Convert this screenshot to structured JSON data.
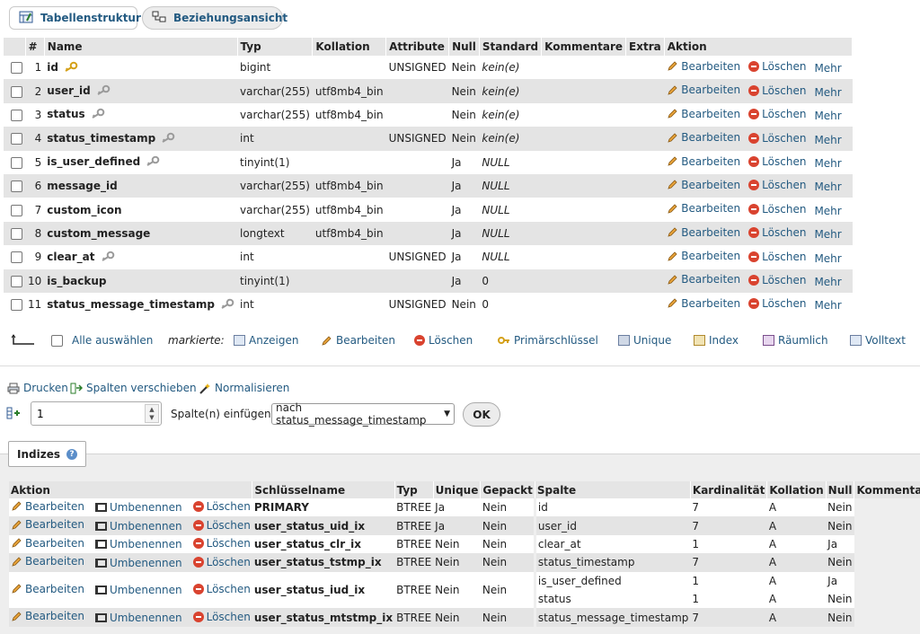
{
  "tabs": [
    {
      "label": "Tabellenstruktur",
      "icon": "table-structure-icon"
    },
    {
      "label": "Beziehungsansicht",
      "icon": "relation-view-icon"
    }
  ],
  "structure": {
    "headers": [
      "#",
      "Name",
      "Typ",
      "Kollation",
      "Attribute",
      "Null",
      "Standard",
      "Kommentare",
      "Extra",
      "Aktion"
    ],
    "action_labels": {
      "edit": "Bearbeiten",
      "delete": "Löschen",
      "more": "Mehr"
    },
    "rows": [
      {
        "num": "1",
        "name": "id",
        "type": "bigint",
        "collation": "",
        "attribute": "UNSIGNED",
        "null": "Nein",
        "default": "kein(e)",
        "key": "primary"
      },
      {
        "num": "2",
        "name": "user_id",
        "type": "varchar(255)",
        "collation": "utf8mb4_bin",
        "attribute": "",
        "null": "Nein",
        "default": "kein(e)",
        "key": "index"
      },
      {
        "num": "3",
        "name": "status",
        "type": "varchar(255)",
        "collation": "utf8mb4_bin",
        "attribute": "",
        "null": "Nein",
        "default": "kein(e)",
        "key": "index"
      },
      {
        "num": "4",
        "name": "status_timestamp",
        "type": "int",
        "collation": "",
        "attribute": "UNSIGNED",
        "null": "Nein",
        "default": "kein(e)",
        "key": "index"
      },
      {
        "num": "5",
        "name": "is_user_defined",
        "type": "tinyint(1)",
        "collation": "",
        "attribute": "",
        "null": "Ja",
        "default": "NULL",
        "key": "index"
      },
      {
        "num": "6",
        "name": "message_id",
        "type": "varchar(255)",
        "collation": "utf8mb4_bin",
        "attribute": "",
        "null": "Ja",
        "default": "NULL",
        "key": ""
      },
      {
        "num": "7",
        "name": "custom_icon",
        "type": "varchar(255)",
        "collation": "utf8mb4_bin",
        "attribute": "",
        "null": "Ja",
        "default": "NULL",
        "key": ""
      },
      {
        "num": "8",
        "name": "custom_message",
        "type": "longtext",
        "collation": "utf8mb4_bin",
        "attribute": "",
        "null": "Ja",
        "default": "NULL",
        "key": ""
      },
      {
        "num": "9",
        "name": "clear_at",
        "type": "int",
        "collation": "",
        "attribute": "UNSIGNED",
        "null": "Ja",
        "default": "NULL",
        "key": "index"
      },
      {
        "num": "10",
        "name": "is_backup",
        "type": "tinyint(1)",
        "collation": "",
        "attribute": "",
        "null": "Ja",
        "default": "0",
        "key": ""
      },
      {
        "num": "11",
        "name": "status_message_timestamp",
        "type": "int",
        "collation": "",
        "attribute": "UNSIGNED",
        "null": "Nein",
        "default": "0",
        "key": "index"
      }
    ]
  },
  "bulk": {
    "select_all": "Alle auswählen",
    "marked": "markierte:",
    "actions": [
      "Anzeigen",
      "Bearbeiten",
      "Löschen",
      "Primärschlüssel",
      "Unique",
      "Index",
      "Räumlich",
      "Volltext"
    ]
  },
  "tools": {
    "print": "Drucken",
    "move_columns": "Spalten verschieben",
    "normalize": "Normalisieren"
  },
  "add_column": {
    "count": "1",
    "label": "Spalte(n) einfügen",
    "position": "nach status_message_timestamp",
    "ok": "OK"
  },
  "indexes": {
    "legend": "Indizes",
    "headers": [
      "Aktion",
      "Schlüsselname",
      "Typ",
      "Unique",
      "Gepackt",
      "Spalte",
      "Kardinalität",
      "Kollation",
      "Null",
      "Kommentar"
    ],
    "action_labels": {
      "edit": "Bearbeiten",
      "rename": "Umbenennen",
      "delete": "Löschen"
    },
    "rows": [
      {
        "name": "PRIMARY",
        "type": "BTREE",
        "unique": "Ja",
        "packed": "Nein",
        "columns": [
          {
            "col": "id",
            "card": "7",
            "coll": "A",
            "null": "Nein"
          }
        ]
      },
      {
        "name": "user_status_uid_ix",
        "type": "BTREE",
        "unique": "Ja",
        "packed": "Nein",
        "columns": [
          {
            "col": "user_id",
            "card": "7",
            "coll": "A",
            "null": "Nein"
          }
        ]
      },
      {
        "name": "user_status_clr_ix",
        "type": "BTREE",
        "unique": "Nein",
        "packed": "Nein",
        "columns": [
          {
            "col": "clear_at",
            "card": "1",
            "coll": "A",
            "null": "Ja"
          }
        ]
      },
      {
        "name": "user_status_tstmp_ix",
        "type": "BTREE",
        "unique": "Nein",
        "packed": "Nein",
        "columns": [
          {
            "col": "status_timestamp",
            "card": "7",
            "coll": "A",
            "null": "Nein"
          }
        ]
      },
      {
        "name": "user_status_iud_ix",
        "type": "BTREE",
        "unique": "Nein",
        "packed": "Nein",
        "columns": [
          {
            "col": "is_user_defined",
            "card": "1",
            "coll": "A",
            "null": "Ja"
          },
          {
            "col": "status",
            "card": "1",
            "coll": "A",
            "null": "Nein"
          }
        ]
      },
      {
        "name": "user_status_mtstmp_ix",
        "type": "BTREE",
        "unique": "Nein",
        "packed": "Nein",
        "columns": [
          {
            "col": "status_message_timestamp",
            "card": "7",
            "coll": "A",
            "null": "Nein"
          }
        ]
      }
    ]
  },
  "colors": {
    "link": "#235a81",
    "row_alt": "#e4e4e4",
    "header": "#e5e5e5",
    "delete": "#d9432f",
    "key_primary": "#d4a017",
    "key_index": "#9a9a9a"
  }
}
